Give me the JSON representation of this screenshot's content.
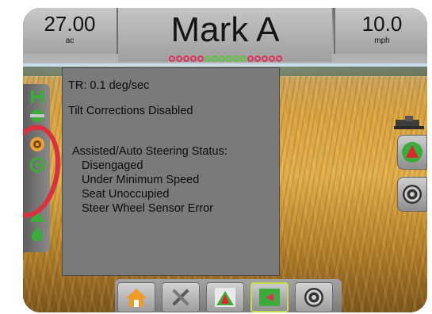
{
  "topbar": {
    "area": {
      "value": "27.00",
      "unit": "ac"
    },
    "title": "Mark A",
    "speed": {
      "value": "10.0",
      "unit": "mph"
    },
    "guidance_dots": [
      "red",
      "red",
      "red",
      "red",
      "red",
      "green",
      "green",
      "green",
      "green",
      "green",
      "green",
      "red",
      "red",
      "red",
      "red",
      "red"
    ]
  },
  "popup": {
    "turn_rate": "TR: 0.1 deg/sec",
    "tilt": "Tilt Corrections Disabled",
    "status_heading": "Assisted/Auto Steering Status:",
    "status_items": [
      "Disengaged",
      "Under Minimum Speed",
      "Seat Unoccupied",
      "Steer Wheel Sensor Error"
    ]
  },
  "sidebar": {
    "icons": [
      "boom-status-icon",
      "section-icon",
      "tilt-status-icon",
      "steering-status-icon",
      "guidance-arrow-icon",
      "droplet-icon"
    ]
  },
  "right_buttons": [
    "screen-arrow-icon",
    "view-orbit-icon"
  ],
  "bottom_bar": {
    "buttons": [
      "home-icon",
      "tools-icon",
      "guidance-view-icon",
      "field-map-icon",
      "gauge-icon"
    ]
  },
  "colors": {
    "accent_green": "#3cab3a",
    "dot_red": "#e0315c",
    "dot_green": "#5ac43a",
    "annotation_red": "#d8323f"
  }
}
